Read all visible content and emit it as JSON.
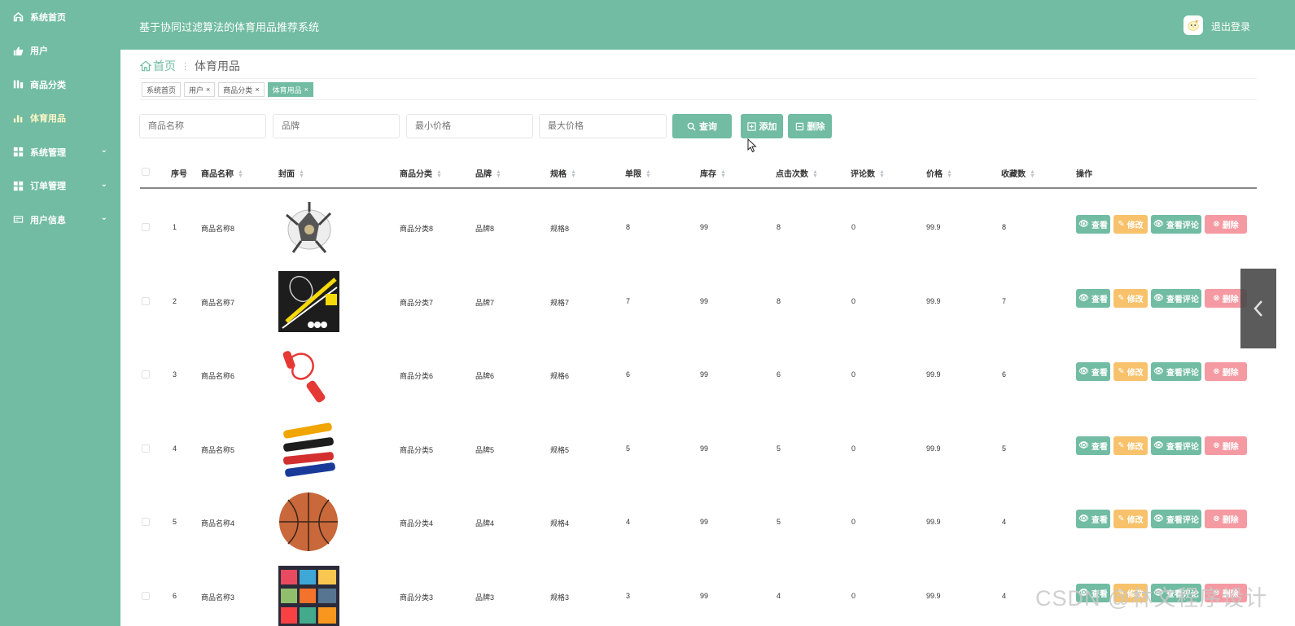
{
  "sidebar": {
    "items": [
      {
        "label": "系统首页"
      },
      {
        "label": "用户"
      },
      {
        "label": "商品分类"
      },
      {
        "label": "体育用品"
      },
      {
        "label": "系统管理"
      },
      {
        "label": "订单管理"
      },
      {
        "label": "用户信息"
      }
    ]
  },
  "header": {
    "title": "基于协同过滤算法的体育用品推荐系统",
    "logout": "退出登录"
  },
  "breadcrumb": {
    "home": "首页",
    "current": "体育用品"
  },
  "tags": [
    {
      "label": "系统首页"
    },
    {
      "label": "用户"
    },
    {
      "label": "商品分类"
    },
    {
      "label": "体育用品"
    }
  ],
  "search": {
    "name_placeholder": "商品名称",
    "brand_placeholder": "品牌",
    "min_price_placeholder": "最小价格",
    "max_price_placeholder": "最大价格",
    "query": "查询",
    "add": "添加",
    "delete": "删除"
  },
  "table": {
    "headers": {
      "index": "序号",
      "name": "商品名称",
      "cover": "封面",
      "category": "商品分类",
      "brand": "品牌",
      "spec": "规格",
      "limit": "单限",
      "stock": "库存",
      "clicks": "点击次数",
      "comments": "评论数",
      "price": "价格",
      "favorites": "收藏数",
      "ops": "操作"
    },
    "actions": {
      "view": "查看",
      "edit": "修改",
      "view_comments": "查看评论",
      "delete": "删除"
    },
    "rows": [
      {
        "index": "1",
        "name": "商品名称8",
        "category": "商品分类8",
        "brand": "品牌8",
        "spec": "规格8",
        "limit": "8",
        "stock": "99",
        "clicks": "8",
        "comments": "0",
        "price": "99.9",
        "favorites": "8"
      },
      {
        "index": "2",
        "name": "商品名称7",
        "category": "商品分类7",
        "brand": "品牌7",
        "spec": "规格7",
        "limit": "7",
        "stock": "99",
        "clicks": "8",
        "comments": "0",
        "price": "99.9",
        "favorites": "7"
      },
      {
        "index": "3",
        "name": "商品名称6",
        "category": "商品分类6",
        "brand": "品牌6",
        "spec": "规格6",
        "limit": "6",
        "stock": "99",
        "clicks": "6",
        "comments": "0",
        "price": "99.9",
        "favorites": "6"
      },
      {
        "index": "4",
        "name": "商品名称5",
        "category": "商品分类5",
        "brand": "品牌5",
        "spec": "规格5",
        "limit": "5",
        "stock": "99",
        "clicks": "5",
        "comments": "0",
        "price": "99.9",
        "favorites": "5"
      },
      {
        "index": "5",
        "name": "商品名称4",
        "category": "商品分类4",
        "brand": "品牌4",
        "spec": "规格4",
        "limit": "4",
        "stock": "99",
        "clicks": "5",
        "comments": "0",
        "price": "99.9",
        "favorites": "4"
      },
      {
        "index": "6",
        "name": "商品名称3",
        "category": "商品分类3",
        "brand": "品牌3",
        "spec": "规格3",
        "limit": "3",
        "stock": "99",
        "clicks": "4",
        "comments": "0",
        "price": "99.9",
        "favorites": "4"
      }
    ]
  },
  "watermark": "CSDN @林文程序设计",
  "colors": {
    "primary": "#71bca2",
    "edit": "#f7c26b",
    "delete": "#f59aa2"
  }
}
